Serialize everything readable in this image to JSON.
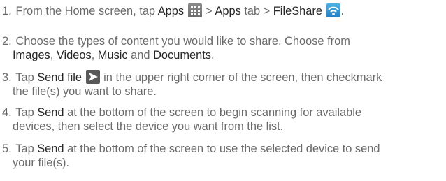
{
  "steps": [
    {
      "num": "1.",
      "t1": " From the Home screen, tap ",
      "b1": "Apps",
      "t2": " > ",
      "b2": "Apps",
      "t3": " tab > ",
      "b3": "FileShare",
      "t4": ".",
      "icon1": "apps-grid-icon",
      "icon2": "fileshare-wifi-icon"
    },
    {
      "num": "2.",
      "t1": " Choose the types of content you would like to share. Choose from",
      "b1": "Images",
      "t2": ", ",
      "b2": "Videos",
      "t3": ", ",
      "b3": "Music",
      "t4": " and ",
      "b4": "Documents",
      "t5": "."
    },
    {
      "num": "3.",
      "t1": " Tap ",
      "b1": "Send file",
      "t2": " in the upper right corner of the screen, then checkmark",
      "t3": "the file(s) you want to share.",
      "icon1": "send-arrow-icon"
    },
    {
      "num": "4.",
      "t1": " Tap ",
      "b1": "Send",
      "t2": " at the bottom of the screen to begin scanning for available",
      "t3": "devices, then select the device you want from the list."
    },
    {
      "num": "5.",
      "t1": " Tap ",
      "b1": "Send",
      "t2": " at the bottom of the screen to use the selected device to send",
      "t3": "your file(s)."
    }
  ],
  "colors": {
    "text": "#6a6a6a",
    "emphasis": "#262626",
    "fileshare_icon": "#2b8ed6"
  }
}
